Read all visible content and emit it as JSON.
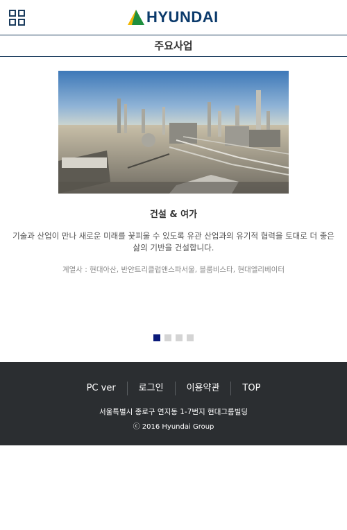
{
  "header": {
    "menu_icon": "grid-menu-icon",
    "logo_text": "HYUNDAI",
    "logo_colors": {
      "green": "#1e8f3e",
      "yellow": "#f2b705",
      "blue": "#0b3a6b"
    }
  },
  "subbar": {
    "title": "주요사업"
  },
  "business": {
    "image_icon": "industrial-plant-photo",
    "title": "건설 & 여가",
    "description": "기술과 산업이 만나 새로운 미래를 꽃피울 수 있도록 유관 산업과의 유기적 협력을 토대로 더 좋은 삶의 기반을 건설합니다.",
    "affiliates": "계열사 : 현대아산, 반얀트리클럽앤스파서울, 블룸비스타, 현대엘리베이터"
  },
  "pagination": {
    "total": 4,
    "active": 1,
    "active_color": "#0a1a7a",
    "inactive_color": "#d4d4d4"
  },
  "footer": {
    "links": [
      "PC ver",
      "로그인",
      "이용약관",
      "TOP"
    ],
    "address": "서울특별시 종로구 연지동 1-7번지 현대그룹빌딩",
    "copyright": "ⓒ 2016 Hyundai Group",
    "background": "#2b2e31"
  }
}
